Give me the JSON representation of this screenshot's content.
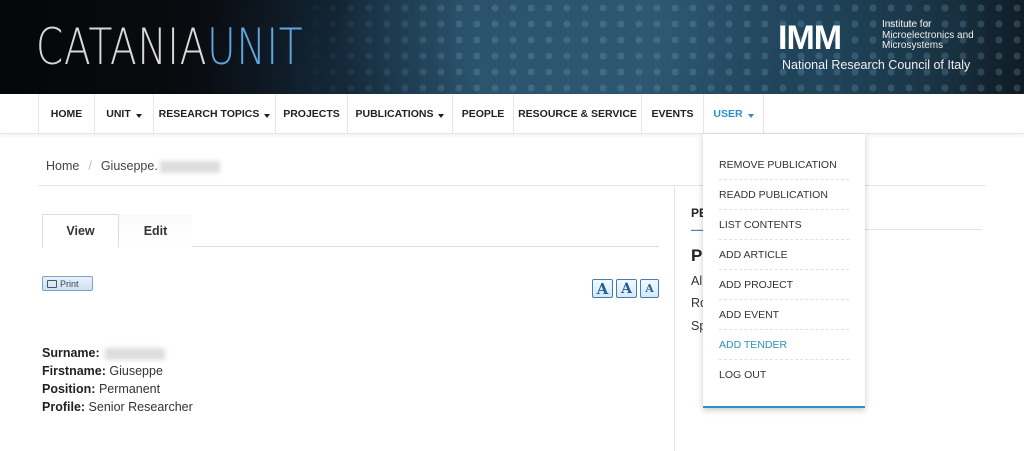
{
  "header": {
    "logo_word1": "CATANIA",
    "logo_word2": "UNIT",
    "imm_mark": "IMM",
    "imm_desc_1": "Institute for",
    "imm_desc_2": "Microelectronics and",
    "imm_desc_3": "Microsystems",
    "imm_cnr": "National Research Council of Italy"
  },
  "nav": {
    "items": [
      {
        "label": "HOME",
        "dropdown": false
      },
      {
        "label": "UNIT",
        "dropdown": true
      },
      {
        "label": "RESEARCH TOPICS",
        "dropdown": true
      },
      {
        "label": "PROJECTS",
        "dropdown": false
      },
      {
        "label": "PUBLICATIONS",
        "dropdown": true
      },
      {
        "label": "PEOPLE",
        "dropdown": false
      },
      {
        "label": "RESOURCE & SERVICE",
        "dropdown": false
      },
      {
        "label": "EVENTS",
        "dropdown": false
      },
      {
        "label": "USER",
        "dropdown": true
      }
    ]
  },
  "breadcrumb": {
    "home": "Home",
    "separator": "/",
    "current": "Giuseppe."
  },
  "tabs": {
    "view": "View",
    "edit": "Edit"
  },
  "tools": {
    "print_label": "Print",
    "font_large": "A",
    "font_medium": "A",
    "font_small": "A"
  },
  "profile": {
    "surname_label": "Surname:",
    "firstname_label": "Firstname:",
    "firstname_value": "Giuseppe",
    "position_label": "Position:",
    "position_value": "Permanent",
    "profile_label": "Profile:",
    "profile_value": "Senior Researcher"
  },
  "sidebar": {
    "title": "PE",
    "heading": "P",
    "line1": "All",
    "line2": "Ro",
    "line3": "Sp"
  },
  "user_menu": {
    "items": [
      "REMOVE PUBLICATION",
      "READD PUBLICATION",
      "LIST CONTENTS",
      "ADD ARTICLE",
      "ADD PROJECT",
      "ADD EVENT",
      "ADD TENDER",
      "LOG OUT"
    ]
  },
  "colors": {
    "accent": "#2d8fc6",
    "logo_unit": "#5fa6dc"
  }
}
